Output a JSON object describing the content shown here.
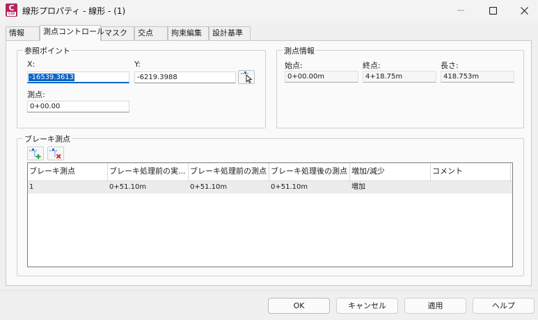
{
  "window": {
    "title": "線形プロパティ - 線形 - (1)",
    "app_icon_letter": "C",
    "app_icon_sub": "C3D",
    "minimize_icon": "minimize-icon",
    "maximize_icon": "maximize-icon",
    "close_icon": "close-icon"
  },
  "tabs": [
    {
      "label": "情報"
    },
    {
      "label": "測点コントロール",
      "active": true
    },
    {
      "label": "マスク"
    },
    {
      "label": "交点"
    },
    {
      "label": "拘束編集"
    },
    {
      "label": "設計基準"
    }
  ],
  "reference_point": {
    "title": "参照ポイント",
    "x_label": "X:",
    "x_value": "-16539.3613",
    "y_label": "Y:",
    "y_value": "-6219.3988",
    "station_label": "測点:",
    "station_value": "0+00.00",
    "pick_icon": "pick-point-icon"
  },
  "station_info": {
    "title": "測点情報",
    "start_label": "始点:",
    "start_value": "0+00.00m",
    "end_label": "終点:",
    "end_value": "4+18.75m",
    "length_label": "長さ:",
    "length_value": "418.753m"
  },
  "breaks": {
    "title": "ブレーキ測点",
    "add_icon": "add-station-equation-icon",
    "delete_icon": "delete-station-equation-icon",
    "columns": [
      "ブレーキ測点",
      "ブレーキ処理前の実...",
      "ブレーキ処理前の測点",
      "ブレーキ処理後の測点",
      "増加/減少",
      "コメント"
    ],
    "rows": [
      {
        "c0": "1",
        "c1": "0+51.10m",
        "c2": "0+51.10m",
        "c3": "0+51.10m",
        "c4": "増加",
        "c5": ""
      }
    ]
  },
  "buttons": {
    "ok": "OK",
    "cancel": "キャンセル",
    "apply": "適用",
    "help": "ヘルプ"
  }
}
